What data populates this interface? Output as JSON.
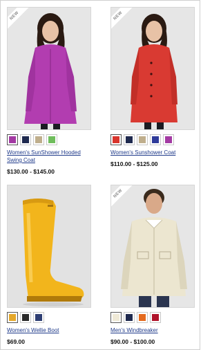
{
  "products": [
    {
      "name": "Women's SunShower Hooded Swing Coat",
      "price": "$130.00 - $145.00",
      "badge": "NEW",
      "swatches": [
        "#a33aa3",
        "#1f2a4f",
        "#bfae8c",
        "#6fbd5c"
      ]
    },
    {
      "name": "Women's Sunshower Coat",
      "price": "$110.00 - $125.00",
      "badge": "NEW",
      "swatches": [
        "#d8342c",
        "#1f2a4f",
        "#bfae8c",
        "#2f3b9a",
        "#a33aa3"
      ]
    },
    {
      "name": "Women's Wellie Boot",
      "price": "$69.00",
      "badge": "",
      "swatches": [
        "#e5a82a",
        "#2a2a2a",
        "#2f3f73"
      ]
    },
    {
      "name": "Men's Windbreaker",
      "price": "$90.00 - $100.00",
      "badge": "NEW",
      "swatches": [
        "#efe9d6",
        "#1f2a4f",
        "#e46a1e",
        "#b0132a"
      ]
    }
  ]
}
